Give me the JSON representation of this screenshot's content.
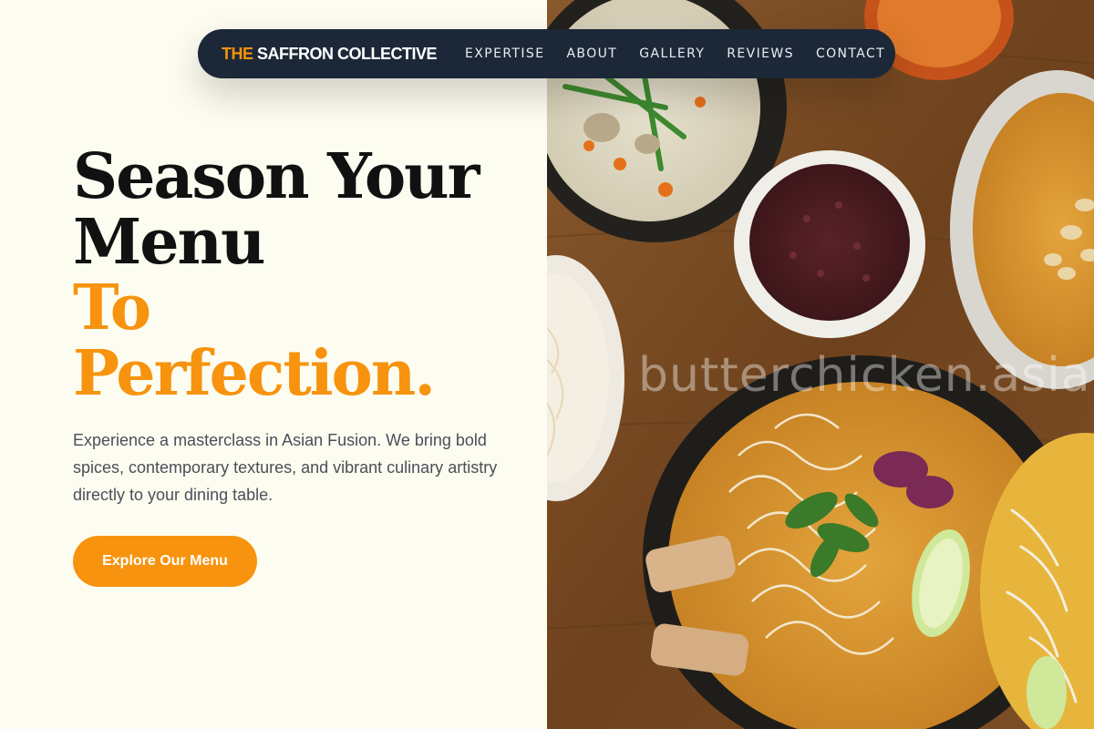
{
  "nav": {
    "brand_accent": "THE",
    "brand_rest": " SAFFRON COLLECTIVE",
    "links": [
      "EXPERTISE",
      "ABOUT",
      "GALLERY",
      "REVIEWS",
      "CONTACT"
    ]
  },
  "hero": {
    "title_line1": "Season Your",
    "title_line2": "Menu",
    "title_line3": "To",
    "title_line4": "Perfection.",
    "description": "Experience a masterclass in Asian Fusion. We bring bold spices, contemporary textures, and vibrant culinary artistry directly to your dining table.",
    "cta_label": "Explore Our Menu"
  },
  "photo": {
    "watermark": "butterchicken.asia"
  },
  "colors": {
    "accent": "#f7930e",
    "nav_bg": "#1c2838",
    "page_bg": "#fdfcf1",
    "heading": "#111111",
    "body_text": "#4b4f57"
  }
}
